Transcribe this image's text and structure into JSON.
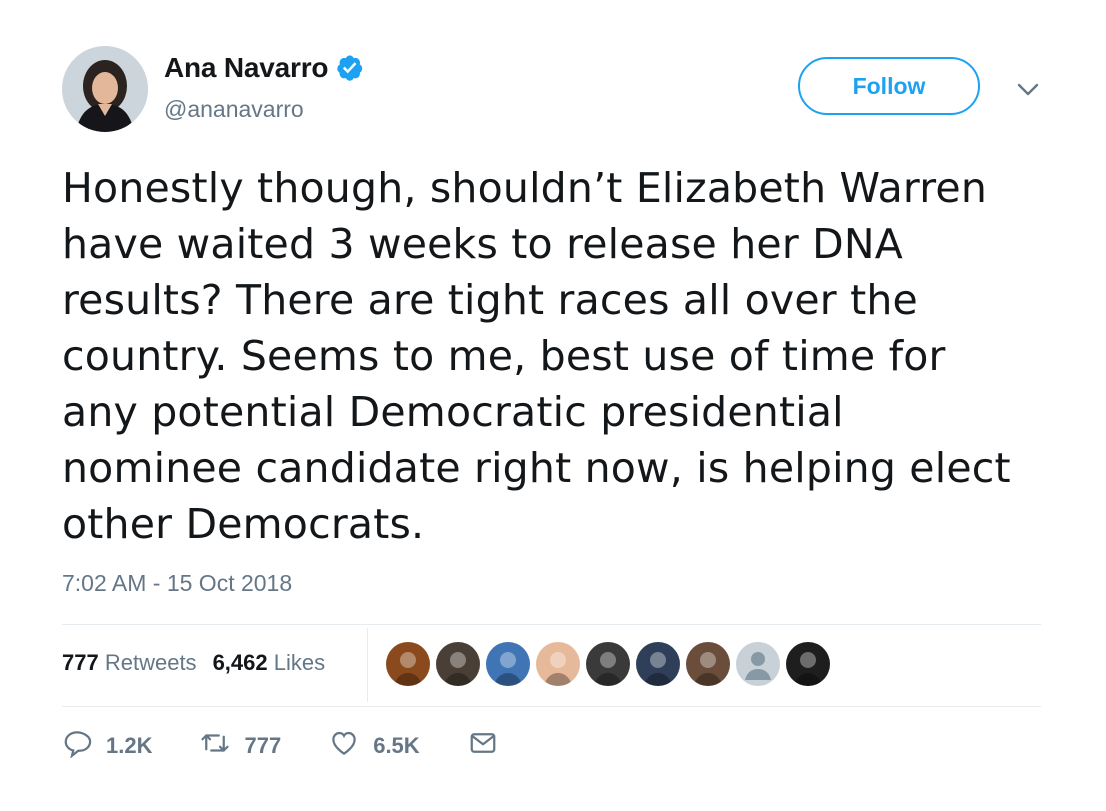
{
  "author": {
    "name": "Ana Navarro",
    "handle": "@ananavarro",
    "avatar_icon": "profile-photo",
    "verified_icon": "verified-badge-icon",
    "verified_color": "#1da1f2"
  },
  "follow_button": {
    "label": "Follow"
  },
  "menu": {
    "icon": "chevron-down-icon"
  },
  "tweet": {
    "text": "Honestly though, shouldn’t  Elizabeth Warren\nhave waited 3 weeks to release her DNA\nresults? There are tight races all over the\ncountry. Seems to me, best use of time for\nany potential Democratic presidential\nnominee candidate right now, is helping elect\nother Democrats.",
    "timestamp": "7:02 AM - 15 Oct 2018"
  },
  "stats": {
    "retweets_count": "777",
    "retweets_label": "Retweets",
    "likes_count": "6,462",
    "likes_label": "Likes"
  },
  "likers": [
    {
      "icon": "liker-avatar",
      "color": "#8a4a1e"
    },
    {
      "icon": "liker-avatar",
      "color": "#4a3f36"
    },
    {
      "icon": "liker-avatar",
      "color": "#3f74b5"
    },
    {
      "icon": "liker-avatar",
      "color": "#e7b99b"
    },
    {
      "icon": "liker-avatar",
      "color": "#3a3a3a"
    },
    {
      "icon": "liker-avatar",
      "color": "#2f3f5a"
    },
    {
      "icon": "liker-avatar",
      "color": "#6b4d3c"
    },
    {
      "icon": "default-avatar",
      "color": "#c8d0d8"
    },
    {
      "icon": "liker-avatar",
      "color": "#1e1e1e"
    }
  ],
  "actions": {
    "reply": {
      "icon": "reply-icon",
      "count": "1.2K"
    },
    "retweet": {
      "icon": "retweet-icon",
      "count": "777"
    },
    "like": {
      "icon": "heart-icon",
      "count": "6.5K"
    },
    "dm": {
      "icon": "envelope-icon"
    }
  },
  "colors": {
    "accent": "#1da1f2",
    "text": "#14171a",
    "secondary": "#657786",
    "divider": "#e6ecf0"
  }
}
